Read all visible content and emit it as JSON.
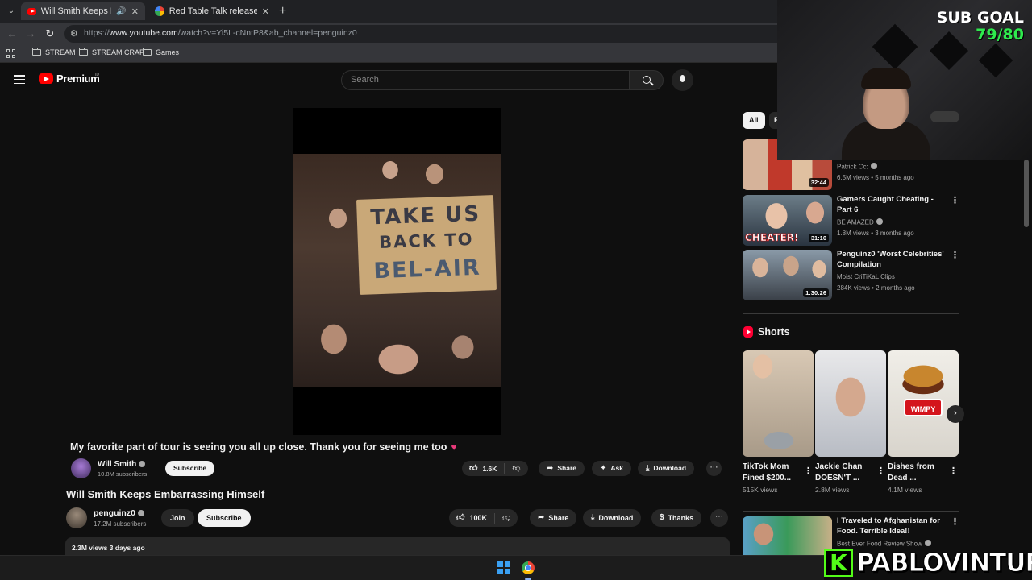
{
  "browser": {
    "tabs": [
      {
        "title": "Will Smith Keeps Embarrass",
        "active": true
      },
      {
        "title": "Red Table Talk release - Google",
        "active": false
      }
    ],
    "url_prefix": "https://",
    "url_host": "www.youtube.com",
    "url_path": "/watch?v=Yi5L-cNntP8&ab_channel=penguinz0",
    "bookmarks": [
      "STREAM",
      "STREAM CRAP",
      "Games"
    ]
  },
  "youtube": {
    "logo_text": "Premium",
    "country_code": "ID",
    "search_placeholder": "Search"
  },
  "video": {
    "sign_lines": [
      "TAKE US",
      "BACK TO",
      "BEL-AIR"
    ],
    "embedded_caption": "My favorite part of tour is seeing you all up close. Thank you for seeing me too",
    "embedded_channel": {
      "name": "Will Smith",
      "subscribers": "10.8M subscribers",
      "subscribe_label": "Subscribe",
      "likes": "1.6K",
      "share_label": "Share",
      "ask_label": "Ask",
      "download_label": "Download"
    },
    "title": "Will Smith Keeps Embarrassing Himself",
    "channel": {
      "name": "penguinz0",
      "subscribers": "17.2M subscribers",
      "join_label": "Join",
      "subscribe_label": "Subscribe"
    },
    "actions": {
      "likes": "100K",
      "share_label": "Share",
      "download_label": "Download",
      "thanks_label": "Thanks"
    },
    "description_meta": "2.3M views  3 days ago"
  },
  "sidebar": {
    "chips": [
      "All",
      "F"
    ],
    "recommendations": [
      {
        "title": "",
        "channel": "Patrick Cc:",
        "views": "6.5M views • 5 months ago",
        "duration": "32:44"
      },
      {
        "title": "Gamers Caught Cheating - Part 6",
        "channel": "BE AMAZED",
        "views": "1.8M views • 3 months ago",
        "duration": "31:10",
        "overlay": "CHEATER!"
      },
      {
        "title": "Penguinz0 'Worst Celebrities' Compilation",
        "channel": "Moist CriTiKaL Clips",
        "views": "284K views • 2 months ago",
        "duration": "1:30:26"
      }
    ],
    "shorts_label": "Shorts",
    "shorts": [
      {
        "title": "TikTok Mom Fined $200...",
        "views": "515K views"
      },
      {
        "title": "Jackie Chan DOESN'T ...",
        "views": "2.8M views"
      },
      {
        "title": "Dishes from Dead ...",
        "views": "4.1M views",
        "badge": "WIMPY"
      }
    ],
    "more_recommendation": {
      "title": "I Traveled to Afghanistan for Food. Terrible Idea!!",
      "channel": "Best Ever Food Review Show"
    }
  },
  "overlay": {
    "sub_goal_label": "SUB GOAL",
    "sub_goal_value": "79/80",
    "streamer_name": "PABLOVINTURA",
    "kick_letter": "K"
  },
  "colors": {
    "youtube_red": "#ff0000",
    "bg": "#0f0f0f",
    "sub_goal_green": "#2eea4d",
    "kick_green": "#53fc18"
  }
}
